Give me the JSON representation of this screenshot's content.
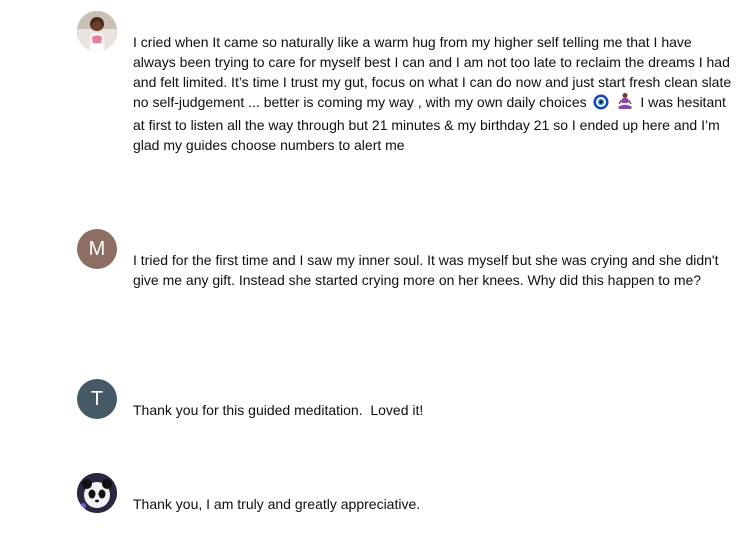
{
  "comments": [
    {
      "avatar_type": "photo",
      "avatar_icon": "woman-photo-avatar",
      "text_before_emoji": "I cried when It came so naturally like a warm hug from my higher self telling me that I have always been trying to care for myself best I can and I am not too late to reclaim the dreams I had and felt limited. It’s time I trust my gut, focus on what I can do now and just start fresh clean slate no self-judgement ... better is coming my way , with my own daily choices",
      "emojis": [
        "nazar-amulet-icon",
        "meditating-person-icon"
      ],
      "text_after_emoji": " I was hesitant at first to listen all the way through but 21 minutes & my birthday 21 so I ended up here and I’m glad my guides choose numbers to alert me"
    },
    {
      "avatar_type": "letter",
      "avatar_letter": "M",
      "avatar_color": "#8d6e63",
      "text": "I tried for the first time and I saw my inner soul. It was myself but she was crying and she didn't give me any gift. Instead she started crying more on her knees. Why did this happen to me?"
    },
    {
      "avatar_type": "letter",
      "avatar_letter": "T",
      "avatar_color": "#455a64",
      "text": "Thank you for this guided meditation.  Loved it!"
    },
    {
      "avatar_type": "photo",
      "avatar_icon": "panda-photo-avatar",
      "text": "Thank you, I am truly and greatly appreciative."
    }
  ]
}
